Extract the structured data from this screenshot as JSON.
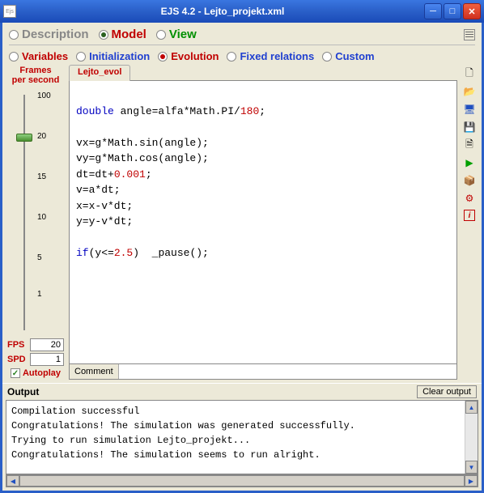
{
  "window": {
    "app_icon_text": "Ejs",
    "title": "EJS 4.2 - Lejto_projekt.xml"
  },
  "main_tabs": {
    "description": "Description",
    "model": "Model",
    "view": "View"
  },
  "sub_tabs": {
    "variables": "Variables",
    "initialization": "Initialization",
    "evolution": "Evolution",
    "fixed": "Fixed relations",
    "custom": "Custom"
  },
  "frames": {
    "header_l1": "Frames",
    "header_l2": "per second",
    "ticks": [
      "100",
      "20",
      "15",
      "10",
      "5",
      "1"
    ],
    "fps_label": "FPS",
    "fps_value": "20",
    "spd_label": "SPD",
    "spd_value": "1",
    "autoplay_label": "Autoplay",
    "autoplay_check": "✓"
  },
  "code": {
    "tab_name": "Lejto_evol",
    "lines": [
      {
        "segs": [
          {
            "t": "",
            "c": ""
          }
        ]
      },
      {
        "segs": [
          {
            "t": "double",
            "c": "kw"
          },
          {
            "t": " angle=alfa*Math.PI/",
            "c": ""
          },
          {
            "t": "180",
            "c": "num"
          },
          {
            "t": ";",
            "c": ""
          }
        ]
      },
      {
        "segs": [
          {
            "t": "",
            "c": ""
          }
        ]
      },
      {
        "segs": [
          {
            "t": "vx=g*Math.sin(angle);",
            "c": ""
          }
        ]
      },
      {
        "segs": [
          {
            "t": "vy=g*Math.cos(angle);",
            "c": ""
          }
        ]
      },
      {
        "segs": [
          {
            "t": "dt=dt+",
            "c": ""
          },
          {
            "t": "0.001",
            "c": "num"
          },
          {
            "t": ";",
            "c": ""
          }
        ]
      },
      {
        "segs": [
          {
            "t": "v=a*dt;",
            "c": ""
          }
        ]
      },
      {
        "segs": [
          {
            "t": "x=x-v*dt;",
            "c": ""
          }
        ]
      },
      {
        "segs": [
          {
            "t": "y=y-v*dt;",
            "c": ""
          }
        ]
      },
      {
        "segs": [
          {
            "t": "",
            "c": ""
          }
        ]
      },
      {
        "segs": [
          {
            "t": "if",
            "c": "kw"
          },
          {
            "t": "(y<=",
            "c": ""
          },
          {
            "t": "2.5",
            "c": "num"
          },
          {
            "t": ")  _pause();",
            "c": ""
          }
        ]
      }
    ],
    "comment_label": "Comment",
    "comment_value": ""
  },
  "output": {
    "title": "Output",
    "clear_button": "Clear output",
    "lines": [
      "Compilation successful",
      "Congratulations! The simulation was generated successfully.",
      "Trying to run simulation Lejto_projekt...",
      "Congratulations! The simulation seems to run alright."
    ]
  },
  "side_icons": {
    "new": "🗋",
    "open": "📂",
    "export": "🖥",
    "save": "💾",
    "saveas": "🗎",
    "run": "▶",
    "package": "📦",
    "options": "⚙",
    "info": "i"
  }
}
